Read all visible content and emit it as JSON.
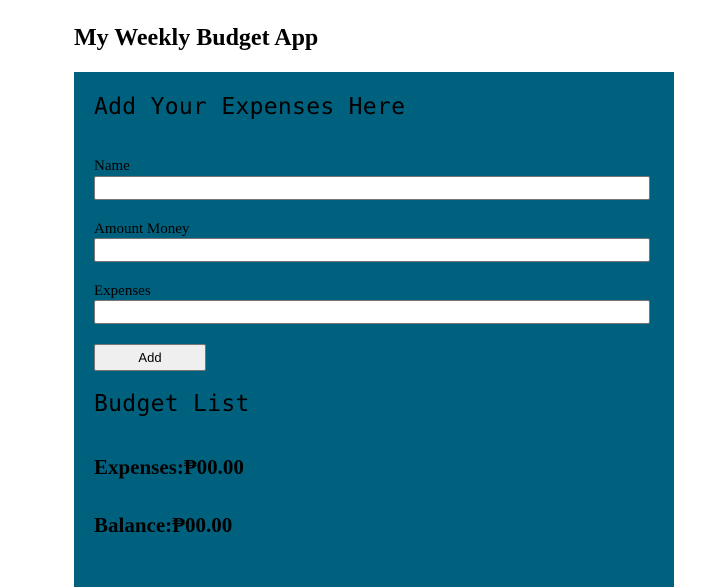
{
  "app": {
    "title": "My Weekly Budget App"
  },
  "form": {
    "heading": "Add Your Expenses Here",
    "fields": [
      {
        "label": "Name",
        "value": "",
        "placeholder": ""
      },
      {
        "label": "Amount Money",
        "value": "",
        "placeholder": ""
      },
      {
        "label": "Expenses",
        "value": "",
        "placeholder": ""
      }
    ],
    "add_label": "Add"
  },
  "budget": {
    "heading": "Budget List",
    "expenses_label": "Expenses:",
    "expenses_value": "₱00.00",
    "balance_label": "Balance:",
    "balance_value": "₱00.00"
  },
  "colors": {
    "panel_background": "#00617f",
    "page_background": "#ffffff",
    "text": "#000000"
  }
}
